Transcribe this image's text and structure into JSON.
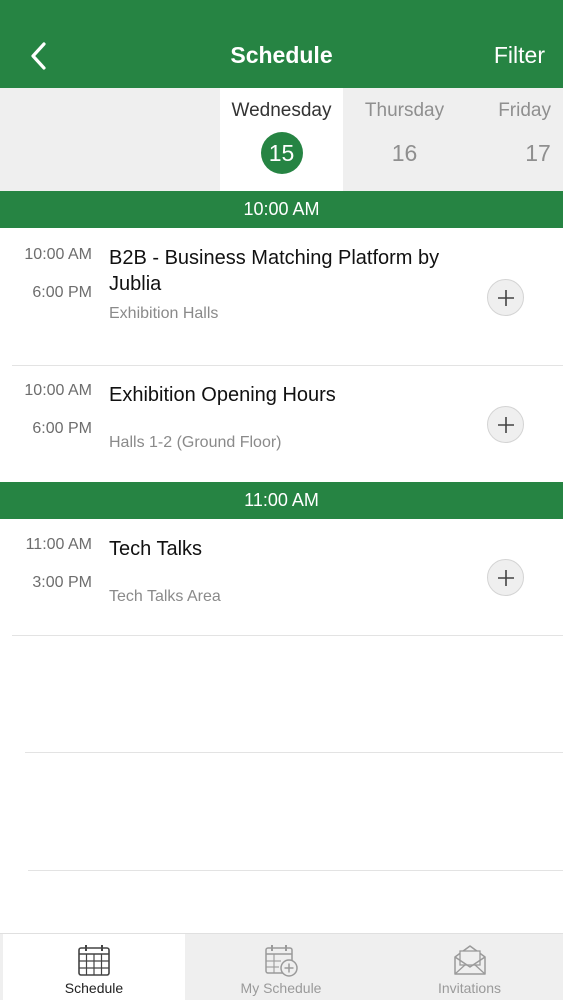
{
  "nav": {
    "title": "Schedule",
    "filter_label": "Filter",
    "back_icon": "chevron-left-icon"
  },
  "days": [
    {
      "name": "Wednesday",
      "num": "15",
      "active": true
    },
    {
      "name": "Thursday",
      "num": "16",
      "active": false
    },
    {
      "name": "Friday",
      "num": "17",
      "active": false
    }
  ],
  "sections": [
    {
      "time_header": "10:00 AM",
      "sessions": [
        {
          "start": "10:00 AM",
          "end": "6:00 PM",
          "title": "B2B - Business Matching Platform by Jublia",
          "location": "Exhibition Halls"
        },
        {
          "start": "10:00 AM",
          "end": "6:00 PM",
          "title": "Exhibition Opening Hours",
          "location": "Halls 1-2 (Ground Floor)"
        }
      ]
    },
    {
      "time_header": "11:00 AM",
      "sessions": [
        {
          "start": "11:00 AM",
          "end": "3:00 PM",
          "title": "Tech Talks",
          "location": "Tech Talks Area"
        }
      ]
    }
  ],
  "tabs": [
    {
      "label": "Schedule",
      "icon": "calendar-grid-icon",
      "active": true
    },
    {
      "label": "My Schedule",
      "icon": "calendar-add-icon",
      "active": false
    },
    {
      "label": "Invitations",
      "icon": "envelope-icon",
      "active": false
    }
  ],
  "colors": {
    "brand": "#268443"
  }
}
